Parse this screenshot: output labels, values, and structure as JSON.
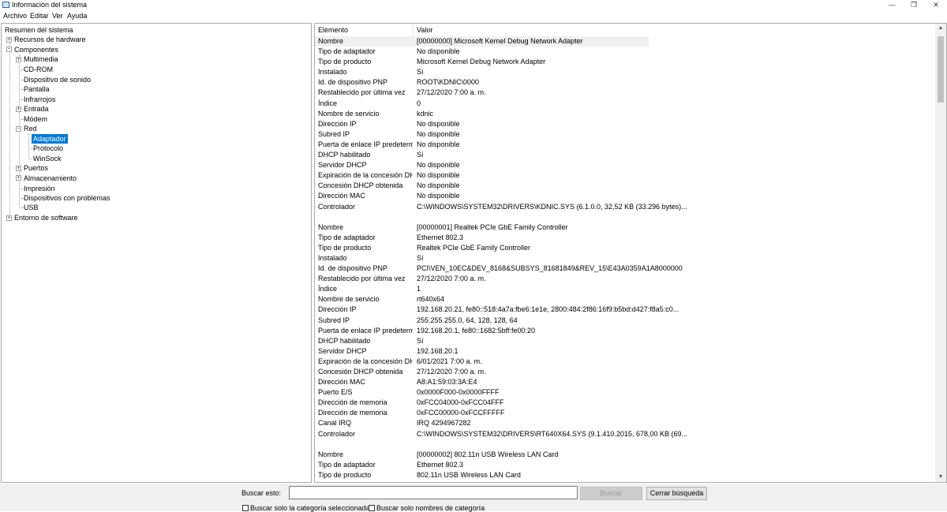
{
  "window": {
    "title": "Información del sistema",
    "controls": [
      "—",
      "❐",
      "✕"
    ]
  },
  "menu": [
    "Archivo",
    "Editar",
    "Ver",
    "Ayuda"
  ],
  "tree": {
    "root": "Resumen del sistema",
    "items": [
      {
        "label": "Recursos de hardware",
        "expander": "+"
      },
      {
        "label": "Componentes",
        "expander": "−"
      },
      {
        "label": "Multimedia",
        "expander": "+"
      },
      {
        "label": "CD-ROM"
      },
      {
        "label": "Dispositivo de sonido"
      },
      {
        "label": "Pantalla"
      },
      {
        "label": "Infrarrojos"
      },
      {
        "label": "Entrada",
        "expander": "+"
      },
      {
        "label": "Módem"
      },
      {
        "label": "Red",
        "expander": "−"
      },
      {
        "label": "Adaptador"
      },
      {
        "label": "Protocolo"
      },
      {
        "label": "WinSock"
      },
      {
        "label": "Puertos",
        "expander": "+"
      },
      {
        "label": "Almacenamiento",
        "expander": "+"
      },
      {
        "label": "Impresión"
      },
      {
        "label": "Dispositivos con problemas"
      },
      {
        "label": "USB"
      },
      {
        "label": "Entorno de software",
        "expander": "+"
      }
    ]
  },
  "list": {
    "columns": [
      "Elemento",
      "Valor"
    ],
    "rows": [
      [
        "Nombre",
        "[00000000] Microsoft Kernel Debug Network Adapter"
      ],
      [
        "Tipo de adaptador",
        "No disponible"
      ],
      [
        "Tipo de producto",
        "Microsoft Kernel Debug Network Adapter"
      ],
      [
        "Instalado",
        "Sí"
      ],
      [
        "Id. de dispositivo PNP",
        "ROOT\\KDNIC\\0000"
      ],
      [
        "Restablecido por última vez",
        "27/12/2020 7:00 a. m."
      ],
      [
        "Índice",
        "0"
      ],
      [
        "Nombre de servicio",
        "kdnic"
      ],
      [
        "Dirección IP",
        "No disponible"
      ],
      [
        "Subred IP",
        "No disponible"
      ],
      [
        "Puerta de enlace IP predetermi...",
        "No disponible"
      ],
      [
        "DHCP habilitado",
        "Sí"
      ],
      [
        "Servidor DHCP",
        "No disponible"
      ],
      [
        "Expiración de la concesión DHCP",
        "No disponible"
      ],
      [
        "Concesión DHCP obtenida",
        "No disponible"
      ],
      [
        "Dirección MAC",
        "No disponible"
      ],
      [
        "Controlador",
        "C:\\WINDOWS\\SYSTEM32\\DRIVERS\\KDNIC.SYS (6.1.0.0, 32,52 KB (33.296 bytes)..."
      ],
      [
        "",
        ""
      ],
      [
        "Nombre",
        "[00000001] Realtek PCIe GbE Family Controller"
      ],
      [
        "Tipo de adaptador",
        "Ethernet 802.3"
      ],
      [
        "Tipo de producto",
        "Realtek PCIe GbE Family Controller"
      ],
      [
        "Instalado",
        "Sí"
      ],
      [
        "Id. de dispositivo PNP",
        "PCI\\VEN_10EC&DEV_8168&SUBSYS_81681849&REV_15\\E43A0359A1A8000000"
      ],
      [
        "Restablecido por última vez",
        "27/12/2020 7:00 a. m."
      ],
      [
        "Índice",
        "1"
      ],
      [
        "Nombre de servicio",
        "rt640x64"
      ],
      [
        "Dirección IP",
        "192.168.20.21, fe80::518:4a7a:fbe6:1e1e, 2800:484:2f86:16f9:b5bd:d427:f8a5:c0..."
      ],
      [
        "Subred IP",
        "255.255.255.0, 64, 128, 128, 64"
      ],
      [
        "Puerta de enlace IP predetermi...",
        "192.168.20.1, fe80::1682:5bff:fe00:20"
      ],
      [
        "DHCP habilitado",
        "Sí"
      ],
      [
        "Servidor DHCP",
        "192.168.20.1"
      ],
      [
        "Expiración de la concesión DHCP",
        "6/01/2021 7:00 a. m."
      ],
      [
        "Concesión DHCP obtenida",
        "27/12/2020 7:00 a. m."
      ],
      [
        "Dirección MAC",
        "A8:A1:59:03:3A:E4"
      ],
      [
        "Puerto E/S",
        "0x0000F000-0x0000FFFF"
      ],
      [
        "Dirección de memoria",
        "0xFCC04000-0xFCC04FFF"
      ],
      [
        "Dirección de memoria",
        "0xFCC00000-0xFCCFFFFF"
      ],
      [
        "Canal IRQ",
        "IRQ 4294967282"
      ],
      [
        "Controlador",
        "C:\\WINDOWS\\SYSTEM32\\DRIVERS\\RT640X64.SYS (9.1.410.2015, 678,00 KB (69..."
      ],
      [
        "",
        ""
      ],
      [
        "Nombre",
        "[00000002] 802.11n USB Wireless LAN Card"
      ],
      [
        "Tipo de adaptador",
        "Ethernet 802.3"
      ],
      [
        "Tipo de producto",
        "802.11n USB Wireless LAN Card"
      ]
    ]
  },
  "search": {
    "label": "Buscar esto:",
    "value": "",
    "find_button": "Buscar",
    "close_button": "Cerrar búsqueda",
    "check_selected_category": "Buscar solo la categoría seleccionada",
    "check_category_names": "Buscar solo nombres de categoría"
  }
}
